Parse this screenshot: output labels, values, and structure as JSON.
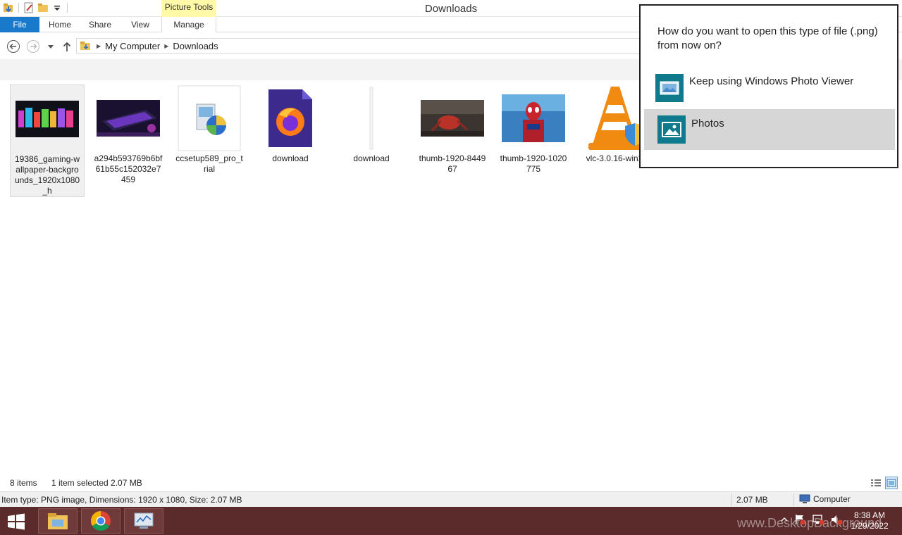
{
  "window": {
    "title": "Downloads",
    "contextual_tab_group": "Picture Tools"
  },
  "ribbon": {
    "tabs": [
      "File",
      "Home",
      "Share",
      "View",
      "Manage"
    ]
  },
  "address_bar": {
    "crumbs": [
      "My Computer",
      "Downloads"
    ]
  },
  "files": [
    {
      "name": "19386_gaming-wallpaper-backgrounds_1920x1080_h",
      "type": "image",
      "selected": true
    },
    {
      "name": "a294b593769b6bf61b55c152032e7459",
      "type": "image",
      "selected": false
    },
    {
      "name": "ccsetup589_pro_trial",
      "type": "installer",
      "selected": false
    },
    {
      "name": "download",
      "type": "firefox-icon",
      "selected": false
    },
    {
      "name": "download",
      "type": "blank",
      "selected": false
    },
    {
      "name": "thumb-1920-844967",
      "type": "image",
      "selected": false
    },
    {
      "name": "thumb-1920-1020775",
      "type": "image",
      "selected": false
    },
    {
      "name": "vlc-3.0.16-win3",
      "type": "vlc-icon",
      "selected": false
    }
  ],
  "status": {
    "count": "8 items",
    "selection": "1 item selected  2.07 MB"
  },
  "details": {
    "info": "Item type: PNG image, Dimensions: 1920 x 1080, Size: 2.07 MB",
    "size": "2.07 MB",
    "location": "Computer"
  },
  "open_with": {
    "question": "How do you want to open this type of file (.png) from now on?",
    "options": [
      {
        "label": "Keep using Windows Photo Viewer",
        "highlighted": false
      },
      {
        "label": "Photos",
        "highlighted": true
      }
    ]
  },
  "taskbar": {
    "time": "8:38 AM",
    "date": "1/29/2022",
    "watermark": "www.DesktopBackground"
  },
  "colors": {
    "file_tab": "#1979ca",
    "taskbar": "#5b2a2a",
    "picture_tools": "#fff9a8",
    "app_icon": "#0e7a8c",
    "highlight": "#d6d6d6"
  }
}
